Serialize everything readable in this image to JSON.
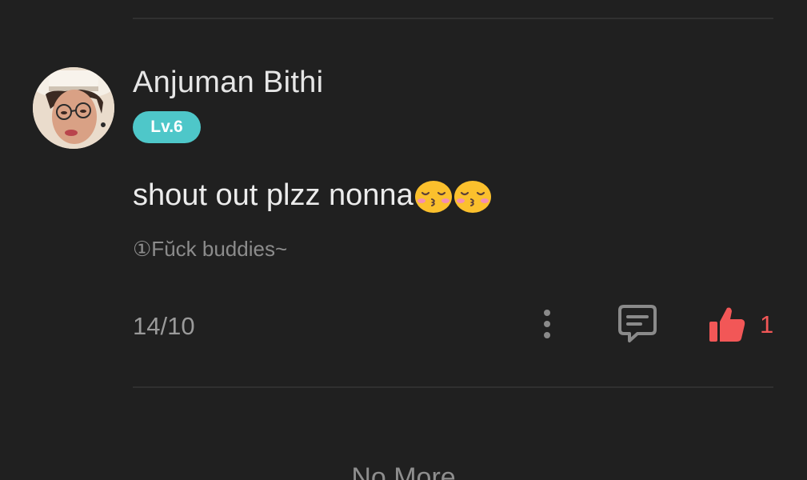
{
  "comment": {
    "author_name": "Anjuman Bithi",
    "level": "Lv.6",
    "text": "shout out plzz nonna",
    "emojis": [
      "kissing-face-with-closed-eyes",
      "kissing-face-with-closed-eyes"
    ],
    "reply_tag": "①Fŭck buddies~",
    "date": "14/10",
    "like_count": "1"
  },
  "footer": {
    "no_more_label": "No More"
  },
  "colors": {
    "background": "#202020",
    "level_badge": "#4ec7c9",
    "like_accent": "#f25757",
    "emoji_yellow": "#fbc02d"
  },
  "icons": {
    "more": "vertical-dots-icon",
    "reply": "chat-bubble-icon",
    "like": "thumbs-up-icon"
  }
}
